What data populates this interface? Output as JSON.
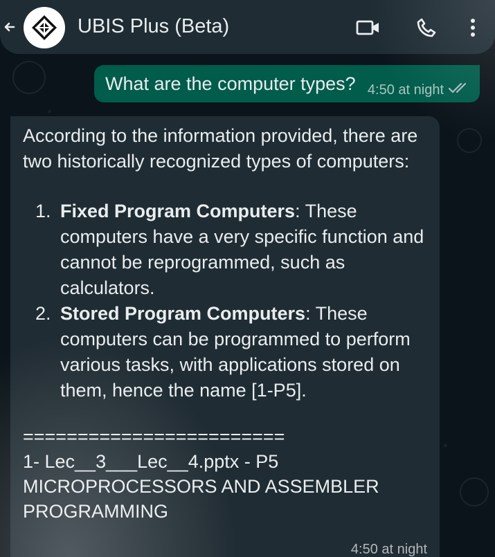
{
  "header": {
    "title": "UBIS Plus (Beta)",
    "icons": {
      "back": "back-arrow-icon",
      "avatar": "app-logo-icon",
      "video": "video-call-icon",
      "call": "phone-call-icon",
      "menu": "more-options-icon"
    }
  },
  "messages": [
    {
      "direction": "outgoing",
      "text": "What are the computer types?",
      "time": "4:50 at night",
      "status": "read"
    },
    {
      "direction": "incoming",
      "intro": "According to the information provided, there are two historically recognized types of computers:",
      "items": [
        {
          "number": "1.",
          "term": "Fixed Program Computers",
          "description": ": These computers have a very specific function and cannot be reprogrammed, such as calculators."
        },
        {
          "number": "2.",
          "term": "Stored Program Computers",
          "description": ": These computers can be programmed to perform various tasks, with applications stored on them, hence the name [1-P5]."
        }
      ],
      "separator": "========================",
      "reference": "1- Lec__3___Lec__4.pptx - P5",
      "reference_title": "MICROPROCESSORS AND ASSEMBLER PROGRAMMING",
      "time": "4:50 at night"
    }
  ],
  "colors": {
    "header_bg": "#1f2c34",
    "chat_bg": "#0b141a",
    "outgoing_bubble": "#005c4b",
    "incoming_bubble": "#202c33",
    "text": "#e9edef"
  }
}
